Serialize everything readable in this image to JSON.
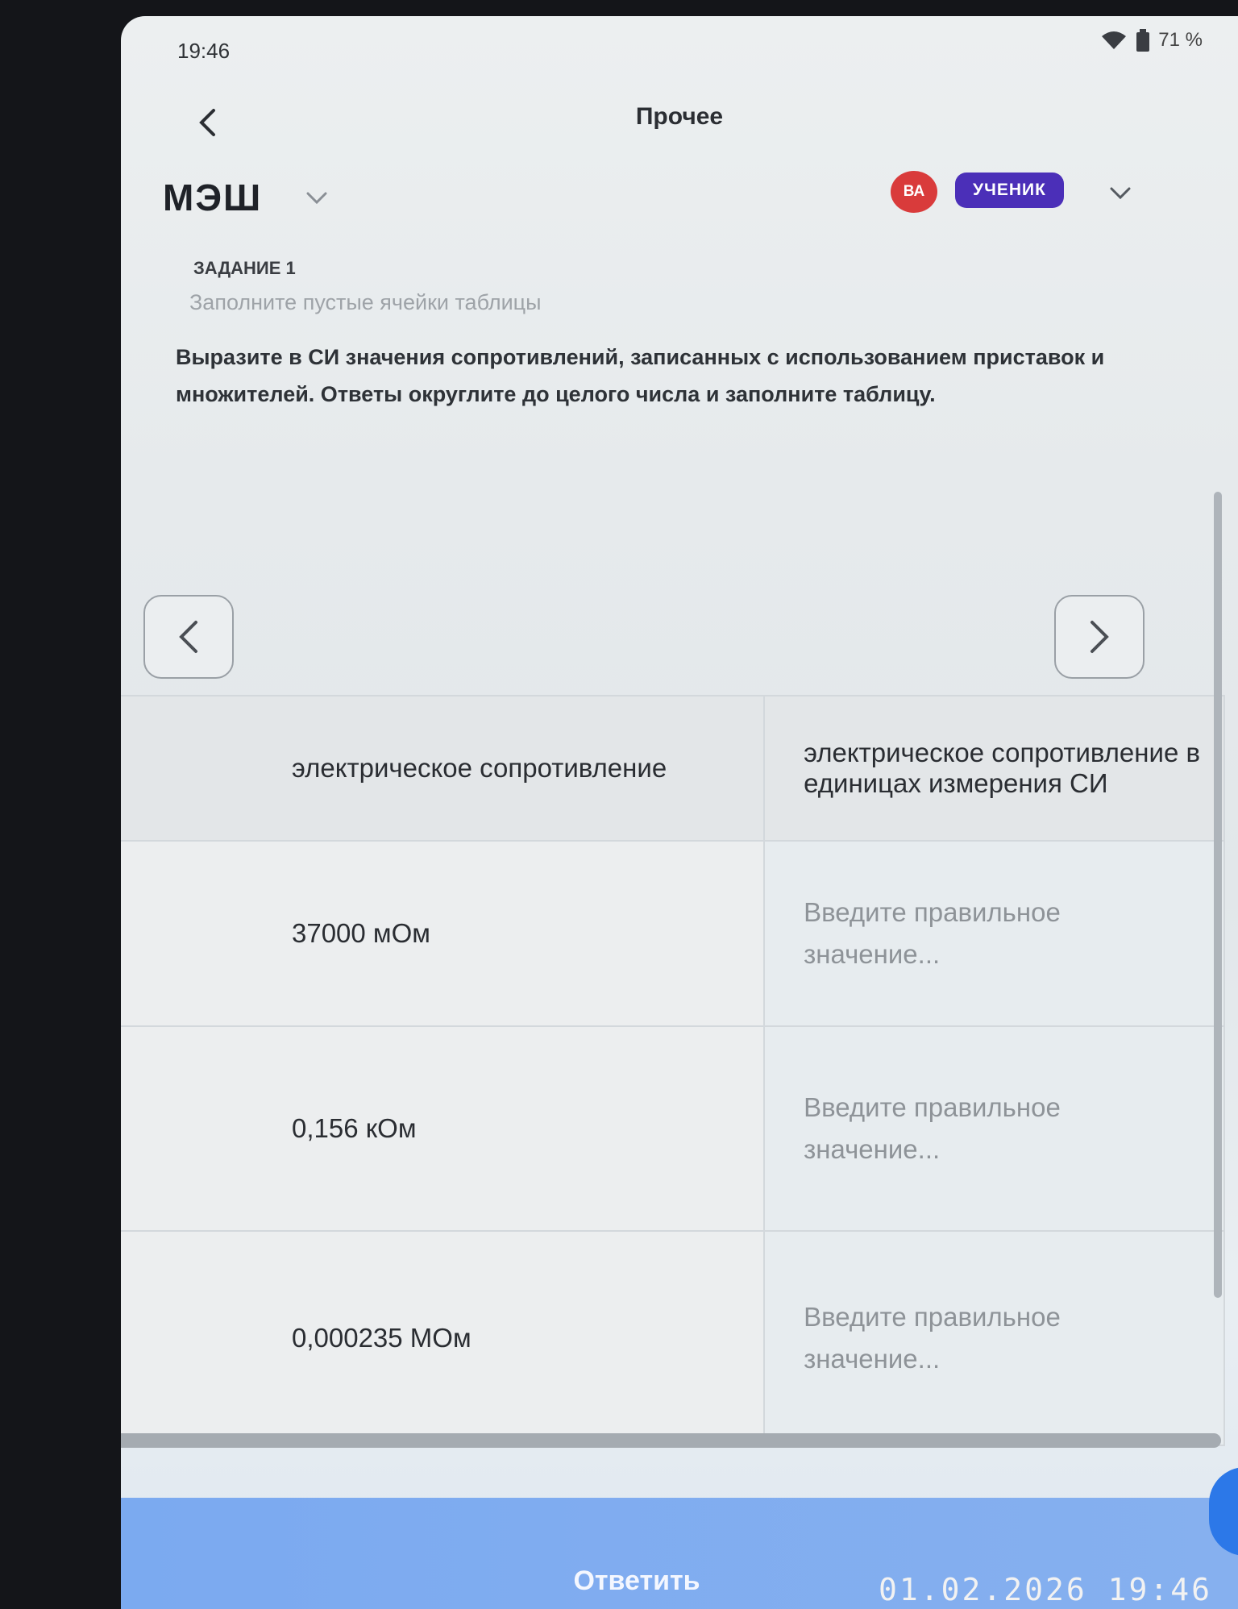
{
  "status": {
    "time": "19:46",
    "battery": "71 %"
  },
  "header": {
    "title": "Прочее"
  },
  "brand": {
    "name": "МЭШ"
  },
  "account": {
    "initials": "ВА",
    "role": "УЧЕНИК"
  },
  "task": {
    "label": "ЗАДАНИЕ 1",
    "subtitle": "Заполните пустые ячейки таблицы",
    "text": "Выразите в СИ значения сопротивлений, записанных с использованием приставок и множителей. Ответы округлите до целого числа и заполните таблицу."
  },
  "table": {
    "headers": [
      "электрическое сопротивление",
      "электрическое сопротивление в единицах измерения СИ"
    ],
    "rows": [
      {
        "value": "37000 мОм",
        "placeholder": "Введите правильное значение..."
      },
      {
        "value": "0,156 кОм",
        "placeholder": "Введите правильное значение..."
      },
      {
        "value": "0,000235 МОм",
        "placeholder": "Введите правильное значение..."
      }
    ]
  },
  "submit": {
    "label": "Ответить"
  },
  "photo_stamp": "01.02.2026  19:46",
  "colors": {
    "accent": "#4b2fb8",
    "avatar": "#d93b3b",
    "submit": "#7aa9f0"
  }
}
